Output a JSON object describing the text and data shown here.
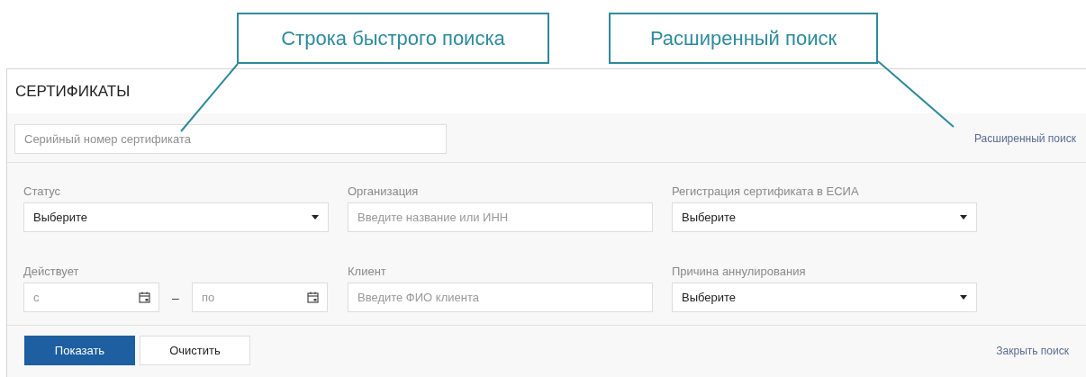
{
  "callouts": [
    {
      "text": "Строка быстрого поиска"
    },
    {
      "text": "Расширенный поиск"
    }
  ],
  "page": {
    "title": "СЕРТИФИКАТЫ",
    "quick_search": {
      "placeholder": "Серийный номер сертификата"
    },
    "advanced_search_link": "Расширенный поиск",
    "filters": [
      {
        "kind": "select",
        "label": "Статус",
        "value": "Выберите"
      },
      {
        "kind": "text",
        "label": "Организация",
        "placeholder": "Введите название или ИНН"
      },
      {
        "kind": "select",
        "label": "Регистрация сертификата в ЕСИА",
        "value": "Выберите"
      },
      {
        "kind": "date_range",
        "label": "Действует",
        "from_placeholder": "с",
        "separator": "–",
        "to_placeholder": "по"
      },
      {
        "kind": "text",
        "label": "Клиент",
        "placeholder": "Введите ФИО клиента"
      },
      {
        "kind": "select",
        "label": "Причина аннулирования",
        "value": "Выберите"
      }
    ],
    "buttons": [
      {
        "label": "Показать",
        "kind": "primary"
      },
      {
        "label": "Очистить",
        "kind": "secondary"
      }
    ],
    "close_search_link": "Закрыть поиск"
  }
}
